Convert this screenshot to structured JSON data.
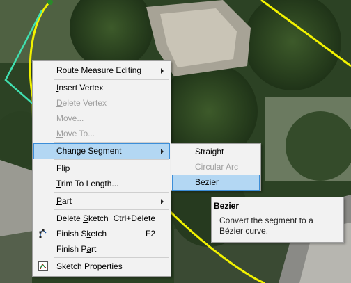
{
  "context_menu": {
    "items": [
      {
        "label": "Route Measure Editing",
        "mnemonic": "R",
        "rest": "oute Measure Editing",
        "submenu": true
      },
      {
        "label": "Insert Vertex",
        "mnemonic": "I",
        "rest": "nsert Vertex"
      },
      {
        "label": "Delete Vertex",
        "mnemonic": "D",
        "rest": "elete Vertex",
        "disabled": true
      },
      {
        "label": "Move...",
        "mnemonic": "M",
        "rest": "ove...",
        "disabled": true
      },
      {
        "label": "Move To...",
        "mnemonic": "M",
        "rest": "ove To...",
        "disabled": true
      },
      {
        "label": "Change Segment",
        "submenu": true,
        "highlighted": true
      },
      {
        "label": "Flip",
        "mnemonic": "F",
        "rest": "lip"
      },
      {
        "label": "Trim To Length...",
        "mnemonic": "T",
        "rest": "rim To Length..."
      },
      {
        "label": "Part",
        "mnemonic": "P",
        "rest": "art",
        "submenu": true
      },
      {
        "label": "Delete Sketch",
        "pre": "Delete ",
        "mnemonic": "S",
        "rest": "ketch",
        "shortcut": "Ctrl+Delete"
      },
      {
        "label": "Finish Sketch",
        "pre": "Finish S",
        "mnemonic": "k",
        "rest": "etch",
        "shortcut": "F2",
        "icon": "finish-sketch-icon"
      },
      {
        "label": "Finish Part",
        "pre": "Finish P",
        "mnemonic": "a",
        "rest": "rt"
      },
      {
        "label": "Sketch Properties",
        "icon": "sketch-properties-icon"
      }
    ]
  },
  "segment_submenu": {
    "items": [
      {
        "label": "Straight"
      },
      {
        "label": "Circular Arc",
        "disabled": true
      },
      {
        "label": "Bezier",
        "highlighted": true
      }
    ]
  },
  "tooltip": {
    "title": "Bezier",
    "body": "Convert the segment to a Bézier curve."
  },
  "colors": {
    "menu_bg": "#f2f2f2",
    "highlight": "#b3d7f3",
    "highlight_border": "#3c8ed8",
    "disabled_text": "#a0a0a0",
    "sketch_yellow": "#f2f200",
    "sketch_cyan": "#40e0b0"
  }
}
